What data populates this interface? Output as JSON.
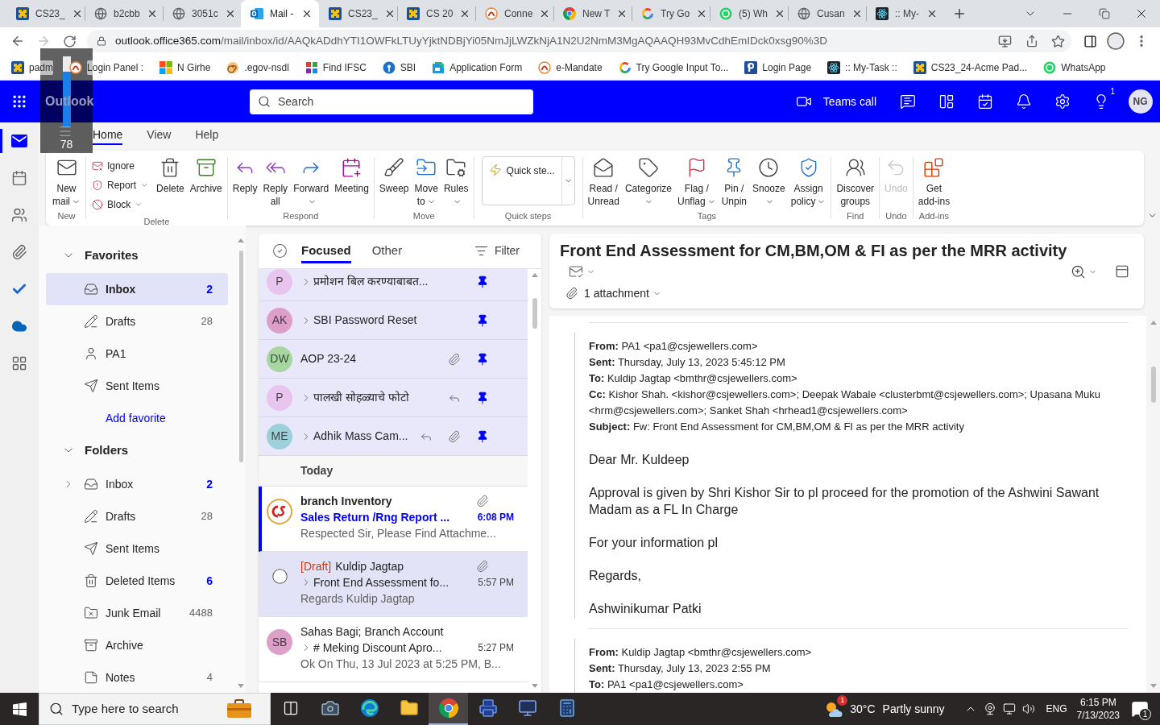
{
  "browser": {
    "tabs": [
      {
        "title": "CS23_",
        "kind": "puzzle",
        "selected": false
      },
      {
        "title": "b2cbb",
        "kind": "globe",
        "selected": false
      },
      {
        "title": "3051c",
        "kind": "globe",
        "selected": false
      },
      {
        "title": "Mail -",
        "kind": "outlook",
        "selected": true
      },
      {
        "title": "CS23_",
        "kind": "puzzle",
        "selected": false
      },
      {
        "title": "CS 20",
        "kind": "puzzle",
        "selected": false
      },
      {
        "title": "Conne",
        "kind": "emblem",
        "selected": false
      },
      {
        "title": "New T",
        "kind": "chrome",
        "selected": false
      },
      {
        "title": "Try Go",
        "kind": "google",
        "selected": false
      },
      {
        "title": "(5) Wh",
        "kind": "whatsapp",
        "selected": false
      },
      {
        "title": "Cusan",
        "kind": "globe",
        "selected": false
      },
      {
        "title": ":: My-",
        "kind": "react",
        "selected": false
      }
    ],
    "url_host": "outlook.office365.com",
    "url_path": "/mail/inbox/id/AAQkADdhYTI1OWFkLTUyYjktNDBjYi05NmJjLWZkNjA1N2U2NmM3MgAQAAQH93MvCdhEmIDck0xsg90%3D",
    "bookmarks": [
      {
        "label": "padm",
        "kind": "puzzle"
      },
      {
        "label": "Login Panel :",
        "kind": "emblem"
      },
      {
        "label": "N Girhe",
        "kind": "windows"
      },
      {
        "label": ".egov-nsdl",
        "kind": "swirl"
      },
      {
        "label": "Find IFSC",
        "kind": "tiles"
      },
      {
        "label": "SBI",
        "kind": "keyhole"
      },
      {
        "label": "Application Form",
        "kind": "form"
      },
      {
        "label": "e-Mandate",
        "kind": "emblem"
      },
      {
        "label": "Try Google Input To...",
        "kind": "google"
      },
      {
        "label": "Login Page",
        "kind": "page"
      },
      {
        "label": ":: My-Task ::",
        "kind": "react"
      },
      {
        "label": "CS23_24-Acme Pad...",
        "kind": "puzzle"
      },
      {
        "label": "WhatsApp",
        "kind": "whatsapp"
      }
    ]
  },
  "osd": {
    "level": 0.78,
    "reading": "78"
  },
  "outlook": {
    "app_name": "Outlook",
    "search": {
      "placeholder": "Search"
    },
    "teams_call": "Teams call",
    "tips_badge": "1",
    "avatar": "NG"
  },
  "ribbon": {
    "tabs": [
      {
        "label": "Home",
        "selected": true
      },
      {
        "label": "View",
        "selected": false
      },
      {
        "label": "Help",
        "selected": false
      }
    ],
    "groups": [
      {
        "label": "New",
        "buttons": [
          {
            "kind": "mail",
            "label": "New\nmail",
            "dropdown": true,
            "disabled": false
          }
        ]
      },
      {
        "label": "Delete",
        "small": [
          {
            "kind": "ignore",
            "label": "Ignore",
            "dropdown": false
          },
          {
            "kind": "report",
            "label": "Report",
            "dropdown": true
          },
          {
            "kind": "block",
            "label": "Block",
            "dropdown": true
          }
        ],
        "buttons": [
          {
            "kind": "delete",
            "label": "Delete",
            "dropdown": false,
            "disabled": false
          },
          {
            "kind": "archive",
            "label": "Archive",
            "dropdown": false,
            "disabled": false
          }
        ]
      },
      {
        "label": "Respond",
        "buttons": [
          {
            "kind": "reply",
            "label": "Reply",
            "dropdown": false,
            "disabled": false
          },
          {
            "kind": "replyall",
            "label": "Reply\nall",
            "dropdown": false,
            "disabled": false
          },
          {
            "kind": "forward",
            "label": "Forward",
            "dropdown": true,
            "disabled": false
          },
          {
            "kind": "meeting",
            "label": "Meeting",
            "dropdown": false,
            "disabled": false
          }
        ]
      },
      {
        "label": "Move",
        "buttons": [
          {
            "kind": "sweep",
            "label": "Sweep",
            "dropdown": false,
            "disabled": false
          },
          {
            "kind": "move",
            "label": "Move\nto",
            "dropdown": true,
            "disabled": false
          },
          {
            "kind": "rules",
            "label": "Rules",
            "dropdown": true,
            "disabled": false
          }
        ]
      },
      {
        "label": "Quick steps",
        "quick_step": "Quick ste..."
      },
      {
        "label": "Tags",
        "buttons": [
          {
            "kind": "read",
            "label": "Read /\nUnread",
            "dropdown": false,
            "disabled": false
          },
          {
            "kind": "categorize",
            "label": "Categorize",
            "dropdown": true,
            "disabled": false
          },
          {
            "kind": "flag",
            "label": "Flag /\nUnflag",
            "dropdown": true,
            "disabled": false
          },
          {
            "kind": "pin",
            "label": "Pin /\nUnpin",
            "dropdown": false,
            "disabled": false
          },
          {
            "kind": "snooze",
            "label": "Snooze",
            "dropdown": true,
            "disabled": false
          },
          {
            "kind": "policy",
            "label": "Assign\npolicy",
            "dropdown": true,
            "disabled": false
          }
        ]
      },
      {
        "label": "Find",
        "buttons": [
          {
            "kind": "groups",
            "label": "Discover\ngroups",
            "dropdown": false,
            "disabled": false
          }
        ]
      },
      {
        "label": "Undo",
        "buttons": [
          {
            "kind": "undo",
            "label": "Undo",
            "dropdown": false,
            "disabled": true
          }
        ]
      },
      {
        "label": "Add-ins",
        "buttons": [
          {
            "kind": "addins",
            "label": "Get\nadd-ins",
            "dropdown": false,
            "disabled": false
          }
        ]
      }
    ]
  },
  "rail": [
    {
      "kind": "mail",
      "selected": true
    },
    {
      "kind": "calendar",
      "selected": false
    },
    {
      "kind": "people",
      "selected": false
    },
    {
      "kind": "files",
      "selected": false
    },
    {
      "kind": "todo",
      "selected": false
    },
    {
      "kind": "cloud",
      "selected": false
    },
    {
      "kind": "apps",
      "selected": false
    }
  ],
  "folders": [
    {
      "title": "Favorites",
      "expanded": true,
      "items": [
        {
          "label": "Inbox",
          "kind": "inbox",
          "count": "2",
          "unread": true,
          "selected": true
        },
        {
          "label": "Drafts",
          "kind": "drafts",
          "count": "28",
          "unread": false,
          "selected": false
        },
        {
          "label": "PA1",
          "kind": "person",
          "selected": false
        },
        {
          "label": "Sent Items",
          "kind": "sent",
          "selected": false
        }
      ],
      "link": "Add favorite"
    },
    {
      "title": "Folders",
      "expanded": true,
      "items": [
        {
          "label": "Inbox",
          "kind": "inbox",
          "count": "2",
          "unread": true,
          "selected": false,
          "expanded": false
        },
        {
          "label": "Drafts",
          "kind": "drafts",
          "count": "28",
          "unread": false,
          "selected": false
        },
        {
          "label": "Sent Items",
          "kind": "sent",
          "selected": false
        },
        {
          "label": "Deleted Items",
          "kind": "deleted",
          "count": "6",
          "unread": true,
          "selected": false
        },
        {
          "label": "Junk Email",
          "kind": "junk",
          "count": "4488",
          "unread": false,
          "selected": false
        },
        {
          "label": "Archive",
          "kind": "archive",
          "selected": false
        },
        {
          "label": "Notes",
          "kind": "notes",
          "count": "4",
          "unread": false,
          "selected": false
        }
      ]
    }
  ],
  "messages": {
    "tabs": [
      {
        "label": "Focused",
        "selected": true
      },
      {
        "label": "Other",
        "selected": false
      }
    ],
    "filter": "Filter",
    "pinned": [
      {
        "avatar": {
          "kind": "initials",
          "text": "P",
          "color": "#e8c5ee"
        },
        "thread": true,
        "subject": "प्रमोशन बिल करण्याबाबत...",
        "replied": false,
        "attachment": false,
        "pinned": true,
        "selected": false
      },
      {
        "avatar": {
          "kind": "initials",
          "text": "AK",
          "color": "#dd9fc9"
        },
        "thread": true,
        "subject": "SBI Password Reset",
        "replied": false,
        "attachment": false,
        "pinned": true,
        "selected": false
      },
      {
        "avatar": {
          "kind": "initials",
          "text": "DW",
          "color": "#a6d7a0"
        },
        "thread": false,
        "subject": "AOP 23-24",
        "replied": false,
        "attachment": true,
        "pinned": true,
        "selected": false
      },
      {
        "avatar": {
          "kind": "initials",
          "text": "P",
          "color": "#e8c5ee"
        },
        "thread": true,
        "subject": "पालखी सोहळ्याचे फोटो",
        "replied": true,
        "attachment": false,
        "pinned": true,
        "selected": false
      },
      {
        "avatar": {
          "kind": "initials",
          "text": "ME",
          "color": "#9ed0d9"
        },
        "thread": true,
        "subject": "Adhik Mass Cam...",
        "replied": true,
        "attachment": true,
        "pinned": true,
        "selected": false
      }
    ],
    "today": {
      "heading": "Today",
      "items": [
        {
          "avatar": {
            "kind": "logo"
          },
          "sender": "branch Inventory",
          "thread": false,
          "subject": "Sales Return /Rng Report ...",
          "time": "6:08 PM",
          "preview": "Respected Sir, Please Find Attachme...",
          "attachment": true,
          "unread": true,
          "selected": false
        },
        {
          "draft": "[Draft]",
          "sender": "Kuldip Jagtap",
          "thread": true,
          "subject": "Front End Assessment fo...",
          "time": "5:57 PM",
          "preview": "Regards Kuldip Jagtap",
          "attachment": true,
          "unread": false,
          "selected": true
        },
        {
          "avatar": {
            "kind": "initials",
            "text": "SB",
            "color": "#dda0c8"
          },
          "sender": "Sahas Bagi; Branch Account",
          "thread": true,
          "subject": "# Meking Discount Apro...",
          "time": "5:27 PM",
          "preview": "Ok On Thu, 13 Jul 2023 at 5:25 PM, B...",
          "attachment": false,
          "unread": false,
          "selected": false
        }
      ]
    }
  },
  "reading": {
    "subject": "Front End Assessment for CM,BM,OM & FI as per the MRR activity",
    "attachments": "1 attachment",
    "messages": [
      {
        "headers": [
          {
            "label": "From:",
            "value": "PA1 <pa1@csjewellers.com>"
          },
          {
            "label": "Sent:",
            "value": "Thursday, July 13, 2023 5:45:12 PM"
          },
          {
            "label": "To:",
            "value": "Kuldip Jagtap <bmthr@csjewellers.com>"
          },
          {
            "label": "Cc:",
            "value": "Kishor Shah. <kishor@csjewellers.com>; Deepak Wabale <clusterbmt@csjewellers.com>; Upasana Muku <hrm@csjewellers.com>; Sanket Shah <hrhead1@csjewellers.com>"
          },
          {
            "label": "Subject:",
            "value": "Fw: Front End Assessment for CM,BM,OM & FI as per the MRR activity"
          }
        ],
        "body": [
          "Dear Mr. Kuldeep",
          "Approval is given by Shri Kishor Sir to pl proceed for the promotion of the Ashwini Sawant Madam as a FL In Charge",
          "For your information pl",
          "Regards,",
          "Ashwinikumar Patki"
        ]
      },
      {
        "headers": [
          {
            "label": "From:",
            "value": "Kuldip Jagtap <bmthr@csjewellers.com>"
          },
          {
            "label": "Sent:",
            "value": "Thursday, July 13, 2023 2:55 PM"
          },
          {
            "label": "To:",
            "value": "PA1 <pa1@csjewellers.com>"
          }
        ]
      }
    ]
  },
  "taskbar": {
    "search": {
      "placeholder": "Type here to search"
    },
    "apps": [
      {
        "kind": "taskview",
        "selected": false
      },
      {
        "kind": "camera",
        "selected": false
      },
      {
        "kind": "edge",
        "selected": false
      },
      {
        "kind": "explorer",
        "selected": false
      },
      {
        "kind": "chrome",
        "selected": true
      },
      {
        "kind": "scanner",
        "selected": false
      },
      {
        "kind": "app",
        "selected": false
      },
      {
        "kind": "calculator",
        "selected": false
      }
    ],
    "weather": {
      "badge": "1",
      "temperature": "30°C",
      "condition": "Partly sunny"
    },
    "language": "ENG",
    "time": "6:15 PM",
    "date": "7/13/2023",
    "notifications": "1"
  }
}
